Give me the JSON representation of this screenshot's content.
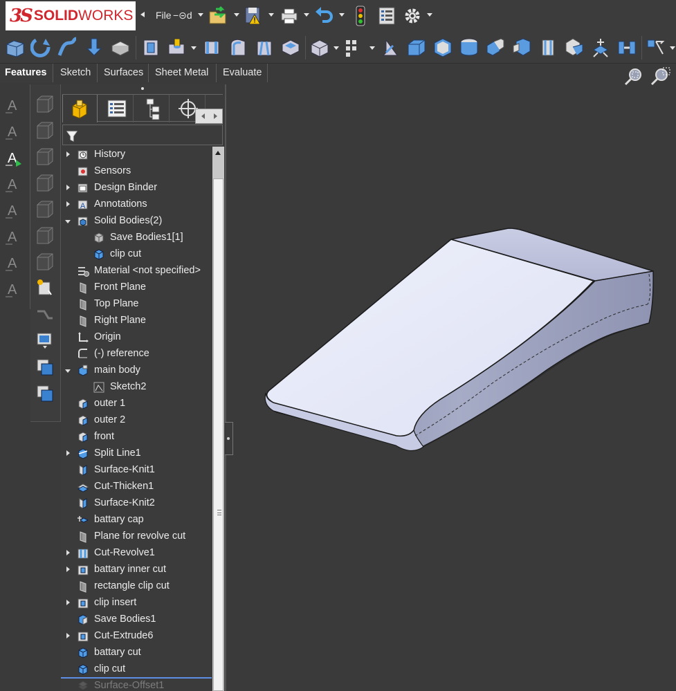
{
  "app": {
    "logo_prefix": "3S",
    "logo_name_bold": "SOLID",
    "logo_name_rest": "WORKS"
  },
  "quick_access": {
    "file_label": "File",
    "pin_label": "−⊝d"
  },
  "tabs": [
    "Features",
    "Sketch",
    "Surfaces",
    "Sheet Metal",
    "Evaluate"
  ],
  "feature_tree": [
    {
      "label": "History",
      "expander": "closed",
      "icon": "history-icon",
      "indent": 0
    },
    {
      "label": "Sensors",
      "expander": "none",
      "icon": "sensors-icon",
      "indent": 0
    },
    {
      "label": "Design Binder",
      "expander": "closed",
      "icon": "design-binder-icon",
      "indent": 0
    },
    {
      "label": "Annotations",
      "expander": "closed",
      "icon": "annotations-icon",
      "indent": 0
    },
    {
      "label": "Solid Bodies(2)",
      "expander": "open",
      "icon": "solid-bodies-icon",
      "indent": 0
    },
    {
      "label": "Save Bodies1[1]",
      "expander": "none",
      "icon": "body-gray-icon",
      "indent": 1
    },
    {
      "label": "clip cut",
      "expander": "none",
      "icon": "body-blue-icon",
      "indent": 1
    },
    {
      "label": "Material <not specified>",
      "expander": "none",
      "icon": "material-icon",
      "indent": 0
    },
    {
      "label": "Front Plane",
      "expander": "none",
      "icon": "plane-icon",
      "indent": 0
    },
    {
      "label": "Top Plane",
      "expander": "none",
      "icon": "plane-icon",
      "indent": 0
    },
    {
      "label": "Right Plane",
      "expander": "none",
      "icon": "plane-icon",
      "indent": 0
    },
    {
      "label": "Origin",
      "expander": "none",
      "icon": "origin-icon",
      "indent": 0
    },
    {
      "label": "(-) reference",
      "expander": "none",
      "icon": "sketch-icon",
      "indent": 0
    },
    {
      "label": "main body",
      "expander": "open",
      "icon": "extrude-icon",
      "indent": 0
    },
    {
      "label": "Sketch2",
      "expander": "none",
      "icon": "sketch-profile-icon",
      "indent": 1
    },
    {
      "label": "outer 1",
      "expander": "none",
      "icon": "cut-icon",
      "indent": 0
    },
    {
      "label": "outer 2",
      "expander": "none",
      "icon": "cut-icon",
      "indent": 0
    },
    {
      "label": "front",
      "expander": "none",
      "icon": "cut-icon",
      "indent": 0
    },
    {
      "label": "Split Line1",
      "expander": "closed",
      "icon": "split-line-icon",
      "indent": 0
    },
    {
      "label": "Surface-Knit1",
      "expander": "none",
      "icon": "surface-knit-icon",
      "indent": 0
    },
    {
      "label": "Cut-Thicken1",
      "expander": "none",
      "icon": "cut-thicken-icon",
      "indent": 0
    },
    {
      "label": "Surface-Knit2",
      "expander": "none",
      "icon": "surface-knit-icon",
      "indent": 0
    },
    {
      "label": "battary cap",
      "expander": "none",
      "icon": "move-body-icon",
      "indent": 0
    },
    {
      "label": "Plane for revolve cut",
      "expander": "none",
      "icon": "plane-icon",
      "indent": 0
    },
    {
      "label": "Cut-Revolve1",
      "expander": "closed",
      "icon": "cut-revolve-icon",
      "indent": 0
    },
    {
      "label": "battary inner cut",
      "expander": "closed",
      "icon": "cut-extrude-icon",
      "indent": 0
    },
    {
      "label": "rectangle clip cut",
      "expander": "none",
      "icon": "plane-icon",
      "indent": 0
    },
    {
      "label": "clip insert",
      "expander": "closed",
      "icon": "cut-extrude-icon",
      "indent": 0
    },
    {
      "label": "Save Bodies1",
      "expander": "none",
      "icon": "save-bodies-icon",
      "indent": 0
    },
    {
      "label": "Cut-Extrude6",
      "expander": "closed",
      "icon": "cut-extrude-icon",
      "indent": 0
    },
    {
      "label": "battary cut",
      "expander": "none",
      "icon": "body-blue-icon",
      "indent": 0
    },
    {
      "label": "clip cut",
      "expander": "none",
      "icon": "body-blue-icon",
      "indent": 0
    },
    {
      "label": "Surface-Offset1",
      "expander": "none",
      "icon": "surface-offset-icon",
      "indent": 0,
      "dimmed": true
    }
  ],
  "colors": {
    "background": "#3a3a3a",
    "panel": "#3b3b3b",
    "brand_red": "#d0262d",
    "rollback_bar": "#5d8fe6",
    "model_top": "#e3e6f7",
    "model_side": "#9ca1bd"
  }
}
